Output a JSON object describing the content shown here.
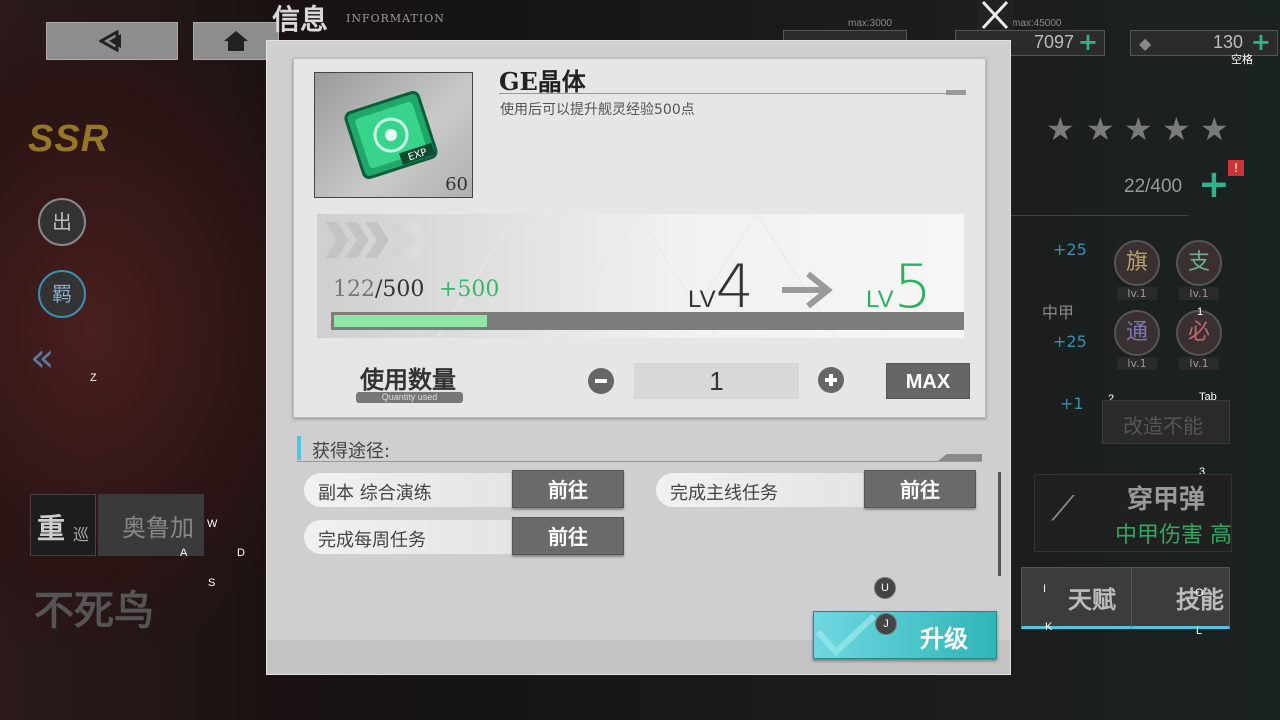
{
  "header": {
    "title": "信息",
    "subtitle": "INFORMATION"
  },
  "resources": [
    {
      "max": "max:3000",
      "value": ""
    },
    {
      "max": "max:45000",
      "value": "7097"
    },
    {
      "max": "",
      "value": "130"
    }
  ],
  "key_hints": {
    "space": "空格",
    "z": "Z",
    "tab": "Tab",
    "n1": "1",
    "n2": "2",
    "n3": "3",
    "w": "W",
    "a": "A",
    "s": "S",
    "d": "D",
    "u": "U",
    "j": "J",
    "i": "I",
    "k": "K",
    "o": "O",
    "l": "L"
  },
  "left": {
    "rarity": "SSR",
    "btn1": "出",
    "btn2": "羁",
    "class_label": "重",
    "class_sub": "巡",
    "ship_class": "奥鲁加",
    "ship_name": "不死鸟"
  },
  "right": {
    "exp_text": "22/400",
    "bonus1": "+25",
    "bonus2": "+25",
    "bonus3": "+1",
    "armor_type": "中甲",
    "skills": [
      {
        "name": "旗",
        "lv": "lv.1"
      },
      {
        "name": "支",
        "lv": "lv.1"
      },
      {
        "name": "通",
        "lv": "lv.1"
      },
      {
        "name": "必",
        "lv": "lv.1"
      }
    ],
    "no_remodel": "改造不能",
    "ammo_type": "穿甲弹",
    "ammo_effect": "中甲伤害 高",
    "tab_talent": "天赋",
    "tab_skill": "技能"
  },
  "item": {
    "name": "GE晶体",
    "description": "使用后可以提升舰灵经验500点",
    "count": "60",
    "exp_current": "122",
    "exp_max": "/500",
    "exp_gain": "+500",
    "exp_fraction": 0.244,
    "lv_prefix": "LV",
    "lv_from": "4",
    "lv_to": "5"
  },
  "quantity": {
    "label": "使用数量",
    "sub_label": "Quantity used",
    "value": "1",
    "max_label": "MAX"
  },
  "sources": {
    "title": "获得途径:",
    "go_label": "前往",
    "items": [
      "副本 综合演练",
      "完成主线任务",
      "完成每周任务"
    ]
  },
  "upgrade_label": "升级",
  "colors": {
    "accent": "#2fb5b8",
    "gain": "#3bb56b",
    "bar_fill": "#8ee6a6"
  }
}
